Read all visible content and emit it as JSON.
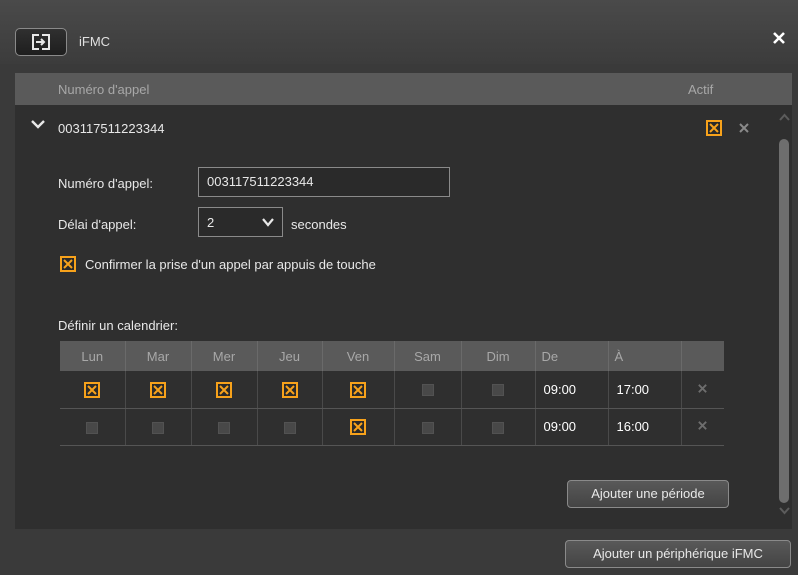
{
  "window": {
    "title": "iFMC"
  },
  "header": {
    "number_col": "Numéro d'appel",
    "active_col": "Actif"
  },
  "entry": {
    "number": "003117511223344",
    "active": true,
    "number_label": "Numéro d'appel:",
    "number_value": "003117511223344",
    "delay_label": "Délai d'appel:",
    "delay_value": "2",
    "delay_unit": "secondes",
    "confirm_checked": true,
    "confirm_label": "Confirmer la prise d'un appel par appuis de touche",
    "calendar_label": "Définir un calendrier:"
  },
  "schedule": {
    "columns": [
      "Lun",
      "Mar",
      "Mer",
      "Jeu",
      "Ven",
      "Sam",
      "Dim",
      "De",
      "À"
    ],
    "rows": [
      {
        "days": [
          true,
          true,
          true,
          true,
          true,
          false,
          false
        ],
        "from": "09:00",
        "to": "17:00"
      },
      {
        "days": [
          false,
          false,
          false,
          false,
          true,
          false,
          false
        ],
        "from": "09:00",
        "to": "16:00"
      }
    ]
  },
  "buttons": {
    "add_period": "Ajouter une période",
    "add_device": "Ajouter un périphérique iFMC"
  },
  "colors": {
    "accent": "#f7a21b",
    "panel": "#2f2f2f",
    "header": "#5a5a5a"
  }
}
